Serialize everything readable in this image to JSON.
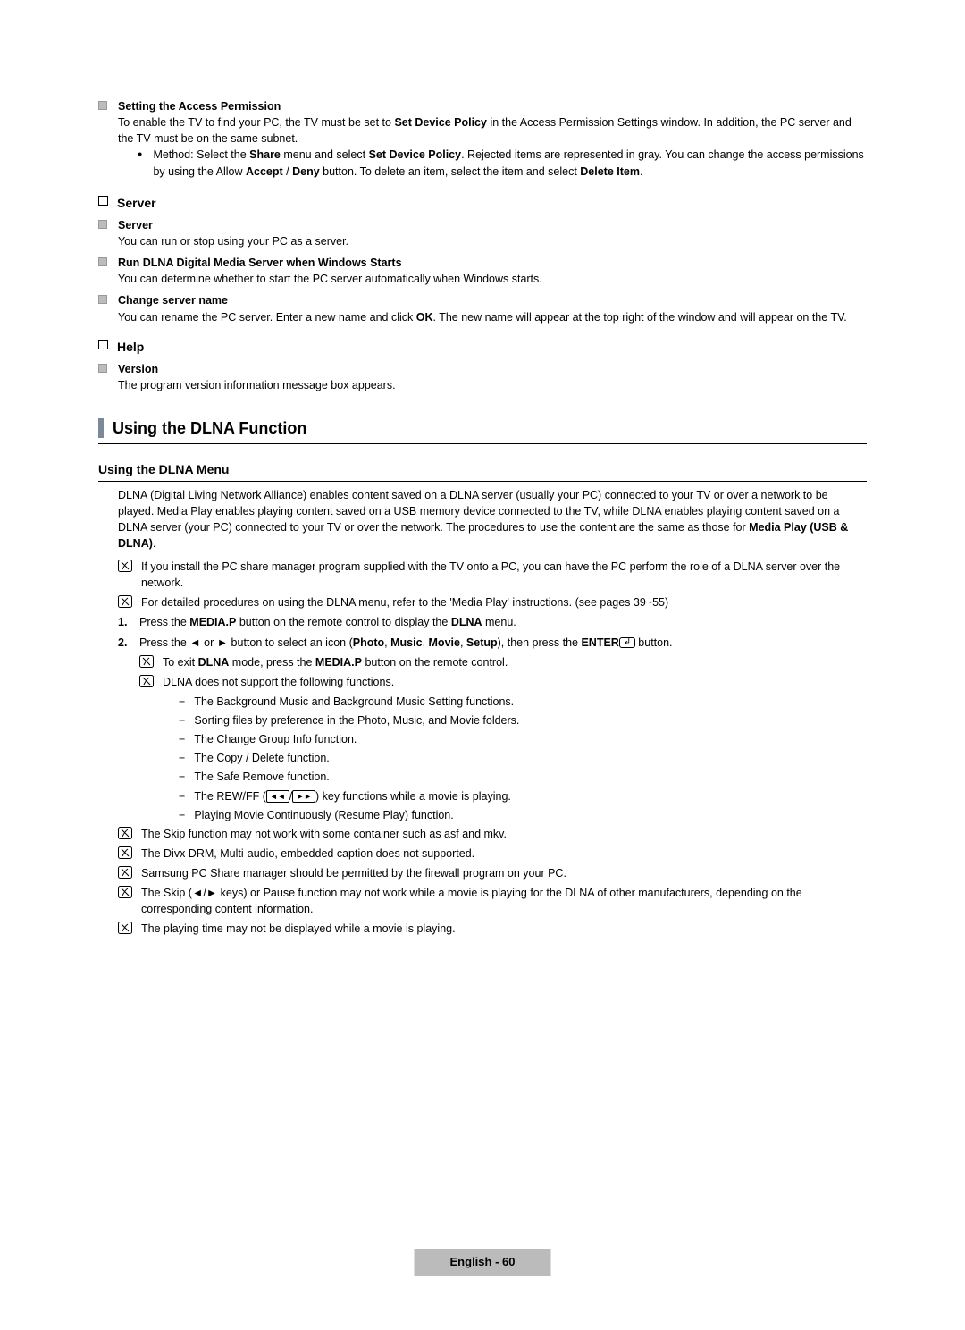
{
  "access": {
    "heading": "Setting the Access Permission",
    "para_before_bold": "To enable the TV to find your PC, the TV must be set to ",
    "para_bold1": "Set Device Policy",
    "para_after_bold": " in the Access Permission Settings window. In addition, the PC server and the TV must be on the same subnet.",
    "method_before": "Method: Select the ",
    "share": "Share",
    "method_mid1": " menu and select ",
    "set_device_policy": "Set Device Policy",
    "method_mid2": ". Rejected items are represented in gray. You can change the access permissions by using the Allow ",
    "accept": "Accept",
    "slash": " / ",
    "deny": "Deny",
    "method_mid3": " button. To delete an item, select the item and select ",
    "delete_item": "Delete Item",
    "period": "."
  },
  "server": {
    "heading": "Server",
    "sub1": "Server",
    "sub1_text": "You can run or stop using your PC as a server.",
    "sub2": "Run DLNA Digital Media Server when Windows Starts",
    "sub2_text": "You can determine whether to start the PC server automatically when Windows starts.",
    "sub3": "Change server name",
    "sub3_text_before": "You can rename the PC server. Enter a new name and click ",
    "ok": "OK",
    "sub3_text_after": ". The new name will appear at the top right of the window and will appear on the TV."
  },
  "help": {
    "heading": "Help",
    "sub1": "Version",
    "sub1_text": "The program version information message box appears."
  },
  "dlna": {
    "section_title": "Using the DLNA Function",
    "subheading": "Using the DLNA Menu",
    "intro_before": "DLNA (Digital Living Network Alliance) enables content saved on a DLNA server (usually your PC) connected to your TV or over a network to be played. Media Play enables playing content saved on a USB memory device connected to the TV, while DLNA enables playing content saved on a DLNA server (your PC) connected to your TV or over the network. The procedures to use the content are the same as those for ",
    "intro_bold": "Media Play (USB & DLNA)",
    "note1": "If you install the PC share manager program supplied with the TV onto a PC, you can have the PC perform the role of a DLNA server over the network.",
    "note2": "For detailed procedures on using the DLNA menu, refer to the 'Media Play' instructions. (see pages 39~55)",
    "step1_before": "Press the ",
    "mediap": "MEDIA.P",
    "step1_mid": " button on the remote control to display the ",
    "dlna_word": "DLNA",
    "step1_after": " menu.",
    "step2_before": "Press the ◄ or ► button to select an icon (",
    "photo": "Photo",
    "music": "Music",
    "movie": "Movie",
    "setup": "Setup",
    "step2_mid": "), then press the ",
    "enter": "ENTER",
    "step2_after": " button.",
    "sub_note_a_before": "To exit ",
    "sub_note_a_mid": " mode, press the ",
    "sub_note_a_after": " button on the remote control.",
    "sub_note_b": "DLNA does not support the following functions.",
    "dash1": "The Background Music and Background Music Setting functions.",
    "dash2": "Sorting files by preference in the Photo, Music, and Movie folders.",
    "dash3": "The Change Group Info function.",
    "dash4": "The Copy / Delete function.",
    "dash5": "The Safe Remove function.",
    "dash6_before": "The REW/FF (",
    "dash6_after": ") key functions while a movie is playing.",
    "dash7": "Playing Movie Continuously (Resume Play) function.",
    "note3": "The Skip function may not work with some container such as asf and mkv.",
    "note4": "The Divx DRM, Multi-audio, embedded caption does not supported.",
    "note5": "Samsung PC Share manager should be permitted by the firewall program on your PC.",
    "note6": "The Skip (◄/► keys) or Pause function may not work while a movie is playing for the DLNA of other manufacturers, depending on the corresponding content information.",
    "note7": "The playing time may not be displayed while a movie is playing."
  },
  "footer": "English - 60",
  "comma": ", "
}
